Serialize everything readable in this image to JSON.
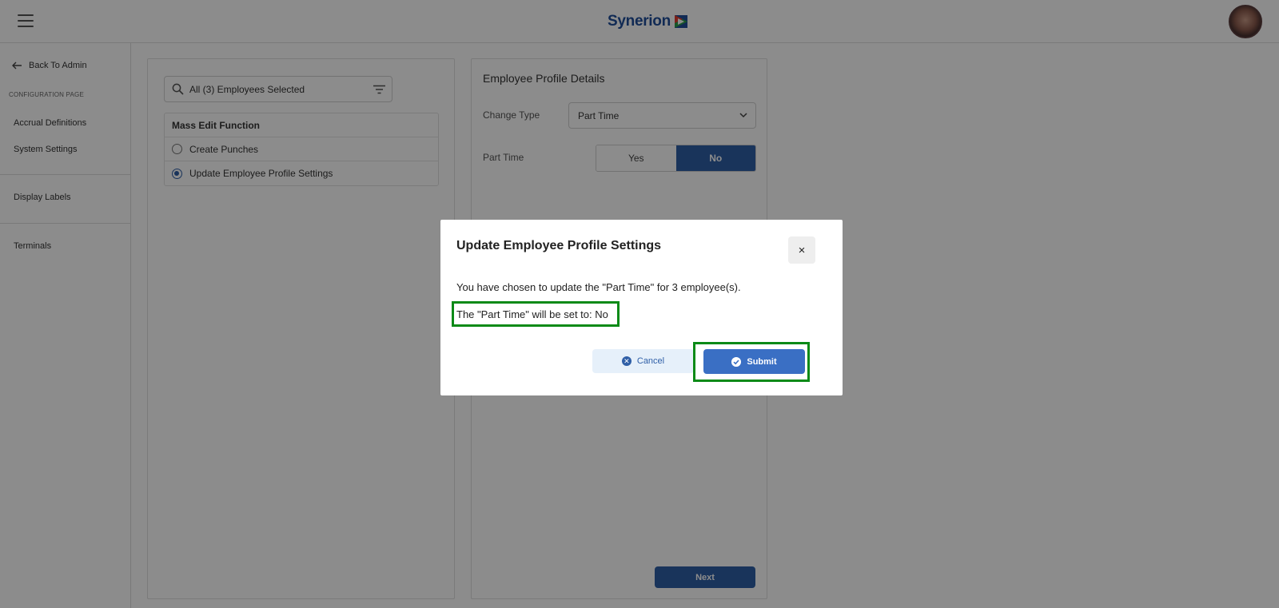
{
  "header": {
    "logo_text": "Synerion",
    "menu_icon": "hamburger-menu-icon",
    "avatar_icon": "user-avatar"
  },
  "sidebar": {
    "back_label": "Back To Admin",
    "section_label": "CONFIGURATION PAGE",
    "items": [
      {
        "label": "Accrual Definitions"
      },
      {
        "label": "System Settings"
      },
      {
        "label": "Display Labels"
      },
      {
        "label": "Terminals"
      }
    ]
  },
  "left_panel": {
    "search_value": "All (3) Employees Selected",
    "mass_edit_header": "Mass Edit Function",
    "options": [
      {
        "label": "Create Punches",
        "selected": false
      },
      {
        "label": "Update Employee Profile Settings",
        "selected": true
      }
    ]
  },
  "right_panel": {
    "title": "Employee Profile Details",
    "change_type_label": "Change Type",
    "change_type_value": "Part Time",
    "part_time_label": "Part Time",
    "yes_label": "Yes",
    "no_label": "No",
    "selected_option": "No",
    "next_label": "Next"
  },
  "modal": {
    "title": "Update Employee Profile Settings",
    "close_label": "×",
    "line1": "You have chosen to update the \"Part Time\" for 3 employee(s).",
    "line2": "The \"Part Time\" will be set to: No",
    "cancel_label": "Cancel",
    "submit_label": "Submit"
  },
  "colors": {
    "primary": "#2f5fa7",
    "highlight": "#0a8a17",
    "overlay": "rgba(0,0,0,0.45)"
  }
}
